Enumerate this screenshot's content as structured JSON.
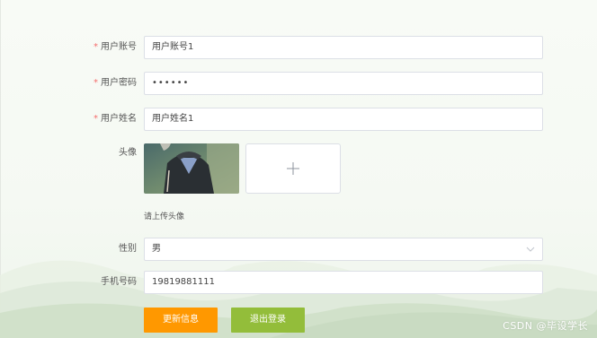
{
  "form": {
    "account": {
      "label": "用户账号",
      "value": "用户账号1",
      "required": true
    },
    "password": {
      "label": "用户密码",
      "value": "••••••",
      "required": true
    },
    "name": {
      "label": "用户姓名",
      "value": "用户姓名1",
      "required": true
    },
    "avatar": {
      "label": "头像",
      "hint": "请上传头像",
      "upload_icon": "plus-icon"
    },
    "gender": {
      "label": "性别",
      "value": "男",
      "icon": "chevron-down-icon"
    },
    "phone": {
      "label": "手机号码",
      "value": "19819881111"
    }
  },
  "actions": {
    "update_label": "更新信息",
    "logout_label": "退出登录"
  },
  "watermark": "CSDN @毕设学长",
  "colors": {
    "required_star": "#f56c6c",
    "update_button": "#ff9800",
    "logout_button": "#93bd3a"
  }
}
